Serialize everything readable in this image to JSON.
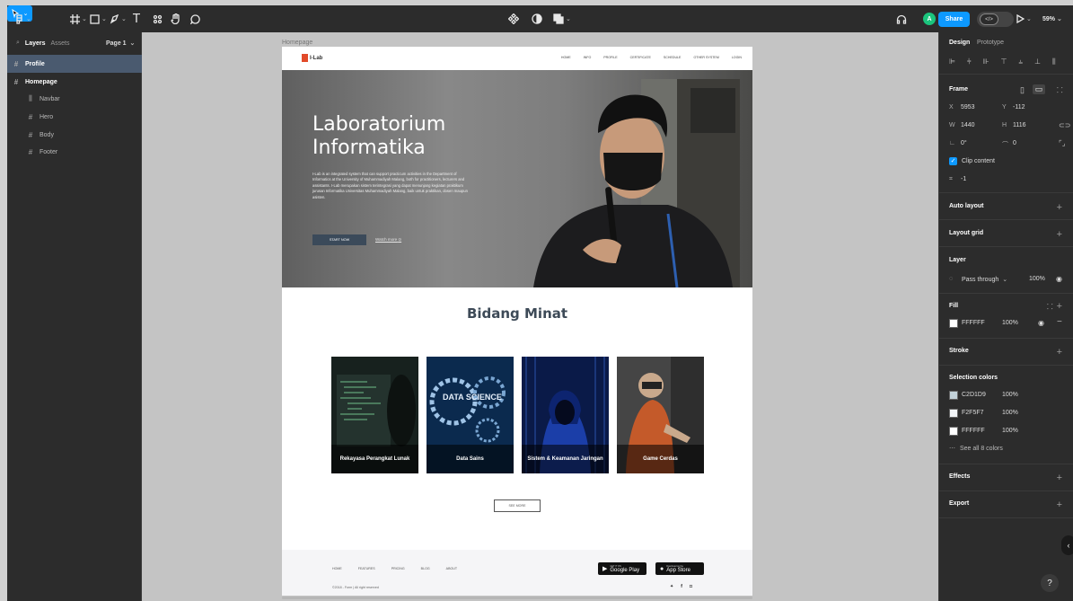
{
  "toolbar": {
    "text_tool": "T",
    "zoom": "59%",
    "share_label": "Share",
    "code_label": "</>",
    "avatar_initial": "A"
  },
  "left_panel": {
    "tab_layers": "Layers",
    "tab_assets": "Assets",
    "page_selector": "Page 1",
    "layers": [
      {
        "label": "Profile"
      },
      {
        "label": "Homepage"
      },
      {
        "label": "Navbar"
      },
      {
        "label": "Hero"
      },
      {
        "label": "Body"
      },
      {
        "label": "Footer"
      }
    ]
  },
  "canvas": {
    "frame_label": "Homepage",
    "site": {
      "logo_text": "I-Lab",
      "nav_links": [
        "HOME",
        "INFO",
        "PROFILE",
        "CERTIFICATE",
        "SCHEDULE",
        "OTHER SYSTEM",
        "LOGIN"
      ],
      "hero_title_line1": "Laboratorium",
      "hero_title_line2": "Informatika",
      "hero_description": "I-Lab is an integrated system that can support practicum activities in the Department of Informatics at the University of Muhammadiyah Malang, both for practitioners, lecturers and assistants. I-Lab merupakan sistem terintegrasi yang dapat menunjang kegiatan praktikum jurusan Informatika Universitas Muhammadiyah Malang, baik untuk praktikan, dosen maupun asisten.",
      "start_button": "START NOW",
      "watch_link": "Watch more",
      "section_title": "Bidang Minat",
      "cards": [
        {
          "label": "Rekayasa Perangkat Lunak"
        },
        {
          "label": "Data Sains"
        },
        {
          "label": "Sistem & Keamanan Jaringan"
        },
        {
          "label": "Game Cerdas"
        }
      ],
      "data_science_text": "DATA SCIENCE",
      "see_more": "SEE MORE",
      "footer_links": [
        "HOME",
        "FEATURES",
        "PRICING",
        "BLOG",
        "ABOUT"
      ],
      "google_play_small": "GET IT ON",
      "google_play_large": "Google Play",
      "app_store_small": "Download on the",
      "app_store_large": "App Store",
      "copyright": "©2018 - Form | All right reserved"
    }
  },
  "right_panel": {
    "tab_design": "Design",
    "tab_prototype": "Prototype",
    "frame_section": "Frame",
    "x_label": "X",
    "x_value": "5953",
    "y_label": "Y",
    "y_value": "-112",
    "w_label": "W",
    "w_value": "1440",
    "h_label": "H",
    "h_value": "1116",
    "rotation": "0°",
    "corner_radius": "0",
    "clip_content": "Clip content",
    "spacing_value": "-1",
    "auto_layout": "Auto layout",
    "layout_grid": "Layout grid",
    "layer_section": "Layer",
    "blend_mode": "Pass through",
    "layer_opacity": "100%",
    "fill_section": "Fill",
    "fill_hex": "FFFFFF",
    "fill_opacity": "100%",
    "stroke_section": "Stroke",
    "selection_colors": "Selection colors",
    "colors": [
      {
        "hex": "C2D1D9",
        "opacity": "100%",
        "swatch": "#C2D1D9"
      },
      {
        "hex": "F2F5F7",
        "opacity": "100%",
        "swatch": "#F2F5F7"
      },
      {
        "hex": "FFFFFF",
        "opacity": "100%",
        "swatch": "#FFFFFF"
      }
    ],
    "see_all_colors": "See all 8 colors",
    "effects": "Effects",
    "export": "Export"
  },
  "help_label": "?",
  "accent_color": "#0d99ff"
}
